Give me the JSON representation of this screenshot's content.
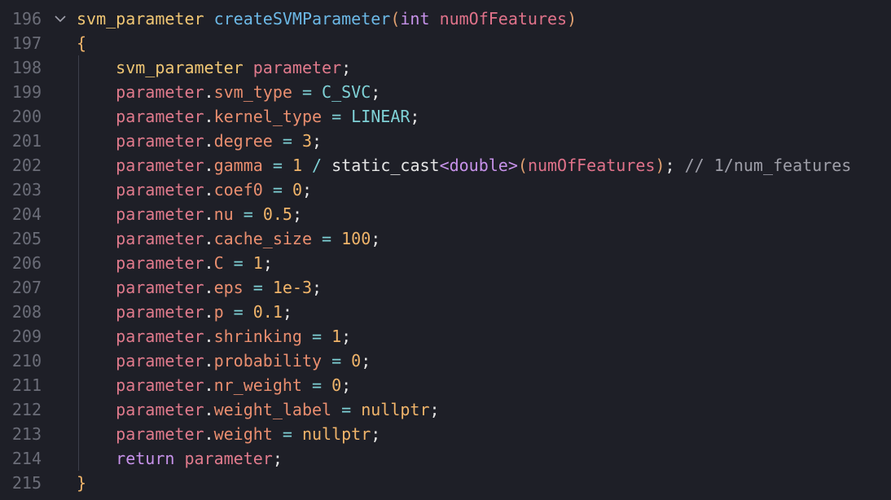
{
  "editor": {
    "colors": {
      "background": "#1e1f27",
      "line_number": "#6b6d78"
    },
    "fold_icon": "chevron-down-icon",
    "lines": [
      {
        "num": "196",
        "tokens": [
          {
            "t": "svm_parameter",
            "c": "type"
          },
          {
            "t": " ",
            "c": "plain"
          },
          {
            "t": "createSVMParameter",
            "c": "fn"
          },
          {
            "t": "(",
            "c": "paren"
          },
          {
            "t": "int",
            "c": "kw"
          },
          {
            "t": " ",
            "c": "plain"
          },
          {
            "t": "numOfFeatures",
            "c": "param"
          },
          {
            "t": ")",
            "c": "paren"
          }
        ]
      },
      {
        "num": "197",
        "tokens": [
          {
            "t": "{",
            "c": "brace"
          }
        ]
      },
      {
        "num": "198",
        "tokens": [
          {
            "t": "    ",
            "c": "plain"
          },
          {
            "t": "svm_parameter",
            "c": "type"
          },
          {
            "t": " ",
            "c": "plain"
          },
          {
            "t": "parameter",
            "c": "var"
          },
          {
            "t": ";",
            "c": "punct"
          }
        ]
      },
      {
        "num": "199",
        "tokens": [
          {
            "t": "    ",
            "c": "plain"
          },
          {
            "t": "parameter",
            "c": "var"
          },
          {
            "t": ".",
            "c": "punct"
          },
          {
            "t": "svm_type",
            "c": "prop"
          },
          {
            "t": " = ",
            "c": "op"
          },
          {
            "t": "C_SVC",
            "c": "const"
          },
          {
            "t": ";",
            "c": "punct"
          }
        ]
      },
      {
        "num": "200",
        "tokens": [
          {
            "t": "    ",
            "c": "plain"
          },
          {
            "t": "parameter",
            "c": "var"
          },
          {
            "t": ".",
            "c": "punct"
          },
          {
            "t": "kernel_type",
            "c": "prop"
          },
          {
            "t": " = ",
            "c": "op"
          },
          {
            "t": "LINEAR",
            "c": "const"
          },
          {
            "t": ";",
            "c": "punct"
          }
        ]
      },
      {
        "num": "201",
        "tokens": [
          {
            "t": "    ",
            "c": "plain"
          },
          {
            "t": "parameter",
            "c": "var"
          },
          {
            "t": ".",
            "c": "punct"
          },
          {
            "t": "degree",
            "c": "prop"
          },
          {
            "t": " = ",
            "c": "op"
          },
          {
            "t": "3",
            "c": "num"
          },
          {
            "t": ";",
            "c": "punct"
          }
        ]
      },
      {
        "num": "202",
        "tokens": [
          {
            "t": "    ",
            "c": "plain"
          },
          {
            "t": "parameter",
            "c": "var"
          },
          {
            "t": ".",
            "c": "punct"
          },
          {
            "t": "gamma",
            "c": "prop"
          },
          {
            "t": " = ",
            "c": "op"
          },
          {
            "t": "1",
            "c": "num"
          },
          {
            "t": " / ",
            "c": "op"
          },
          {
            "t": "static_cast",
            "c": "plain"
          },
          {
            "t": "<double>",
            "c": "angle"
          },
          {
            "t": "(",
            "c": "paren"
          },
          {
            "t": "numOfFeatures",
            "c": "param"
          },
          {
            "t": ")",
            "c": "paren"
          },
          {
            "t": ";",
            "c": "punct"
          },
          {
            "t": " // 1/num_features",
            "c": "cmt"
          }
        ]
      },
      {
        "num": "203",
        "tokens": [
          {
            "t": "    ",
            "c": "plain"
          },
          {
            "t": "parameter",
            "c": "var"
          },
          {
            "t": ".",
            "c": "punct"
          },
          {
            "t": "coef0",
            "c": "prop"
          },
          {
            "t": " = ",
            "c": "op"
          },
          {
            "t": "0",
            "c": "num"
          },
          {
            "t": ";",
            "c": "punct"
          }
        ]
      },
      {
        "num": "204",
        "tokens": [
          {
            "t": "    ",
            "c": "plain"
          },
          {
            "t": "parameter",
            "c": "var"
          },
          {
            "t": ".",
            "c": "punct"
          },
          {
            "t": "nu",
            "c": "prop"
          },
          {
            "t": " = ",
            "c": "op"
          },
          {
            "t": "0.5",
            "c": "num"
          },
          {
            "t": ";",
            "c": "punct"
          }
        ]
      },
      {
        "num": "205",
        "tokens": [
          {
            "t": "    ",
            "c": "plain"
          },
          {
            "t": "parameter",
            "c": "var"
          },
          {
            "t": ".",
            "c": "punct"
          },
          {
            "t": "cache_size",
            "c": "prop"
          },
          {
            "t": " = ",
            "c": "op"
          },
          {
            "t": "100",
            "c": "num"
          },
          {
            "t": ";",
            "c": "punct"
          }
        ]
      },
      {
        "num": "206",
        "tokens": [
          {
            "t": "    ",
            "c": "plain"
          },
          {
            "t": "parameter",
            "c": "var"
          },
          {
            "t": ".",
            "c": "punct"
          },
          {
            "t": "C",
            "c": "prop"
          },
          {
            "t": " = ",
            "c": "op"
          },
          {
            "t": "1",
            "c": "num"
          },
          {
            "t": ";",
            "c": "punct"
          }
        ]
      },
      {
        "num": "207",
        "tokens": [
          {
            "t": "    ",
            "c": "plain"
          },
          {
            "t": "parameter",
            "c": "var"
          },
          {
            "t": ".",
            "c": "punct"
          },
          {
            "t": "eps",
            "c": "prop"
          },
          {
            "t": " = ",
            "c": "op"
          },
          {
            "t": "1e-3",
            "c": "num"
          },
          {
            "t": ";",
            "c": "punct"
          }
        ]
      },
      {
        "num": "208",
        "tokens": [
          {
            "t": "    ",
            "c": "plain"
          },
          {
            "t": "parameter",
            "c": "var"
          },
          {
            "t": ".",
            "c": "punct"
          },
          {
            "t": "p",
            "c": "prop"
          },
          {
            "t": " = ",
            "c": "op"
          },
          {
            "t": "0.1",
            "c": "num"
          },
          {
            "t": ";",
            "c": "punct"
          }
        ]
      },
      {
        "num": "209",
        "tokens": [
          {
            "t": "    ",
            "c": "plain"
          },
          {
            "t": "parameter",
            "c": "var"
          },
          {
            "t": ".",
            "c": "punct"
          },
          {
            "t": "shrinking",
            "c": "prop"
          },
          {
            "t": " = ",
            "c": "op"
          },
          {
            "t": "1",
            "c": "num"
          },
          {
            "t": ";",
            "c": "punct"
          }
        ]
      },
      {
        "num": "210",
        "tokens": [
          {
            "t": "    ",
            "c": "plain"
          },
          {
            "t": "parameter",
            "c": "var"
          },
          {
            "t": ".",
            "c": "punct"
          },
          {
            "t": "probability",
            "c": "prop"
          },
          {
            "t": " = ",
            "c": "op"
          },
          {
            "t": "0",
            "c": "num"
          },
          {
            "t": ";",
            "c": "punct"
          }
        ]
      },
      {
        "num": "211",
        "tokens": [
          {
            "t": "    ",
            "c": "plain"
          },
          {
            "t": "parameter",
            "c": "var"
          },
          {
            "t": ".",
            "c": "punct"
          },
          {
            "t": "nr_weight",
            "c": "prop"
          },
          {
            "t": " = ",
            "c": "op"
          },
          {
            "t": "0",
            "c": "num"
          },
          {
            "t": ";",
            "c": "punct"
          }
        ]
      },
      {
        "num": "212",
        "tokens": [
          {
            "t": "    ",
            "c": "plain"
          },
          {
            "t": "parameter",
            "c": "var"
          },
          {
            "t": ".",
            "c": "punct"
          },
          {
            "t": "weight_label",
            "c": "prop"
          },
          {
            "t": " = ",
            "c": "op"
          },
          {
            "t": "nullptr",
            "c": "num"
          },
          {
            "t": ";",
            "c": "punct"
          }
        ]
      },
      {
        "num": "213",
        "tokens": [
          {
            "t": "    ",
            "c": "plain"
          },
          {
            "t": "parameter",
            "c": "var"
          },
          {
            "t": ".",
            "c": "punct"
          },
          {
            "t": "weight",
            "c": "prop"
          },
          {
            "t": " = ",
            "c": "op"
          },
          {
            "t": "nullptr",
            "c": "num"
          },
          {
            "t": ";",
            "c": "punct"
          }
        ]
      },
      {
        "num": "214",
        "tokens": [
          {
            "t": "    ",
            "c": "plain"
          },
          {
            "t": "return",
            "c": "kw"
          },
          {
            "t": " ",
            "c": "plain"
          },
          {
            "t": "parameter",
            "c": "var"
          },
          {
            "t": ";",
            "c": "punct"
          }
        ]
      },
      {
        "num": "215",
        "tokens": [
          {
            "t": "}",
            "c": "brace"
          }
        ]
      }
    ]
  }
}
